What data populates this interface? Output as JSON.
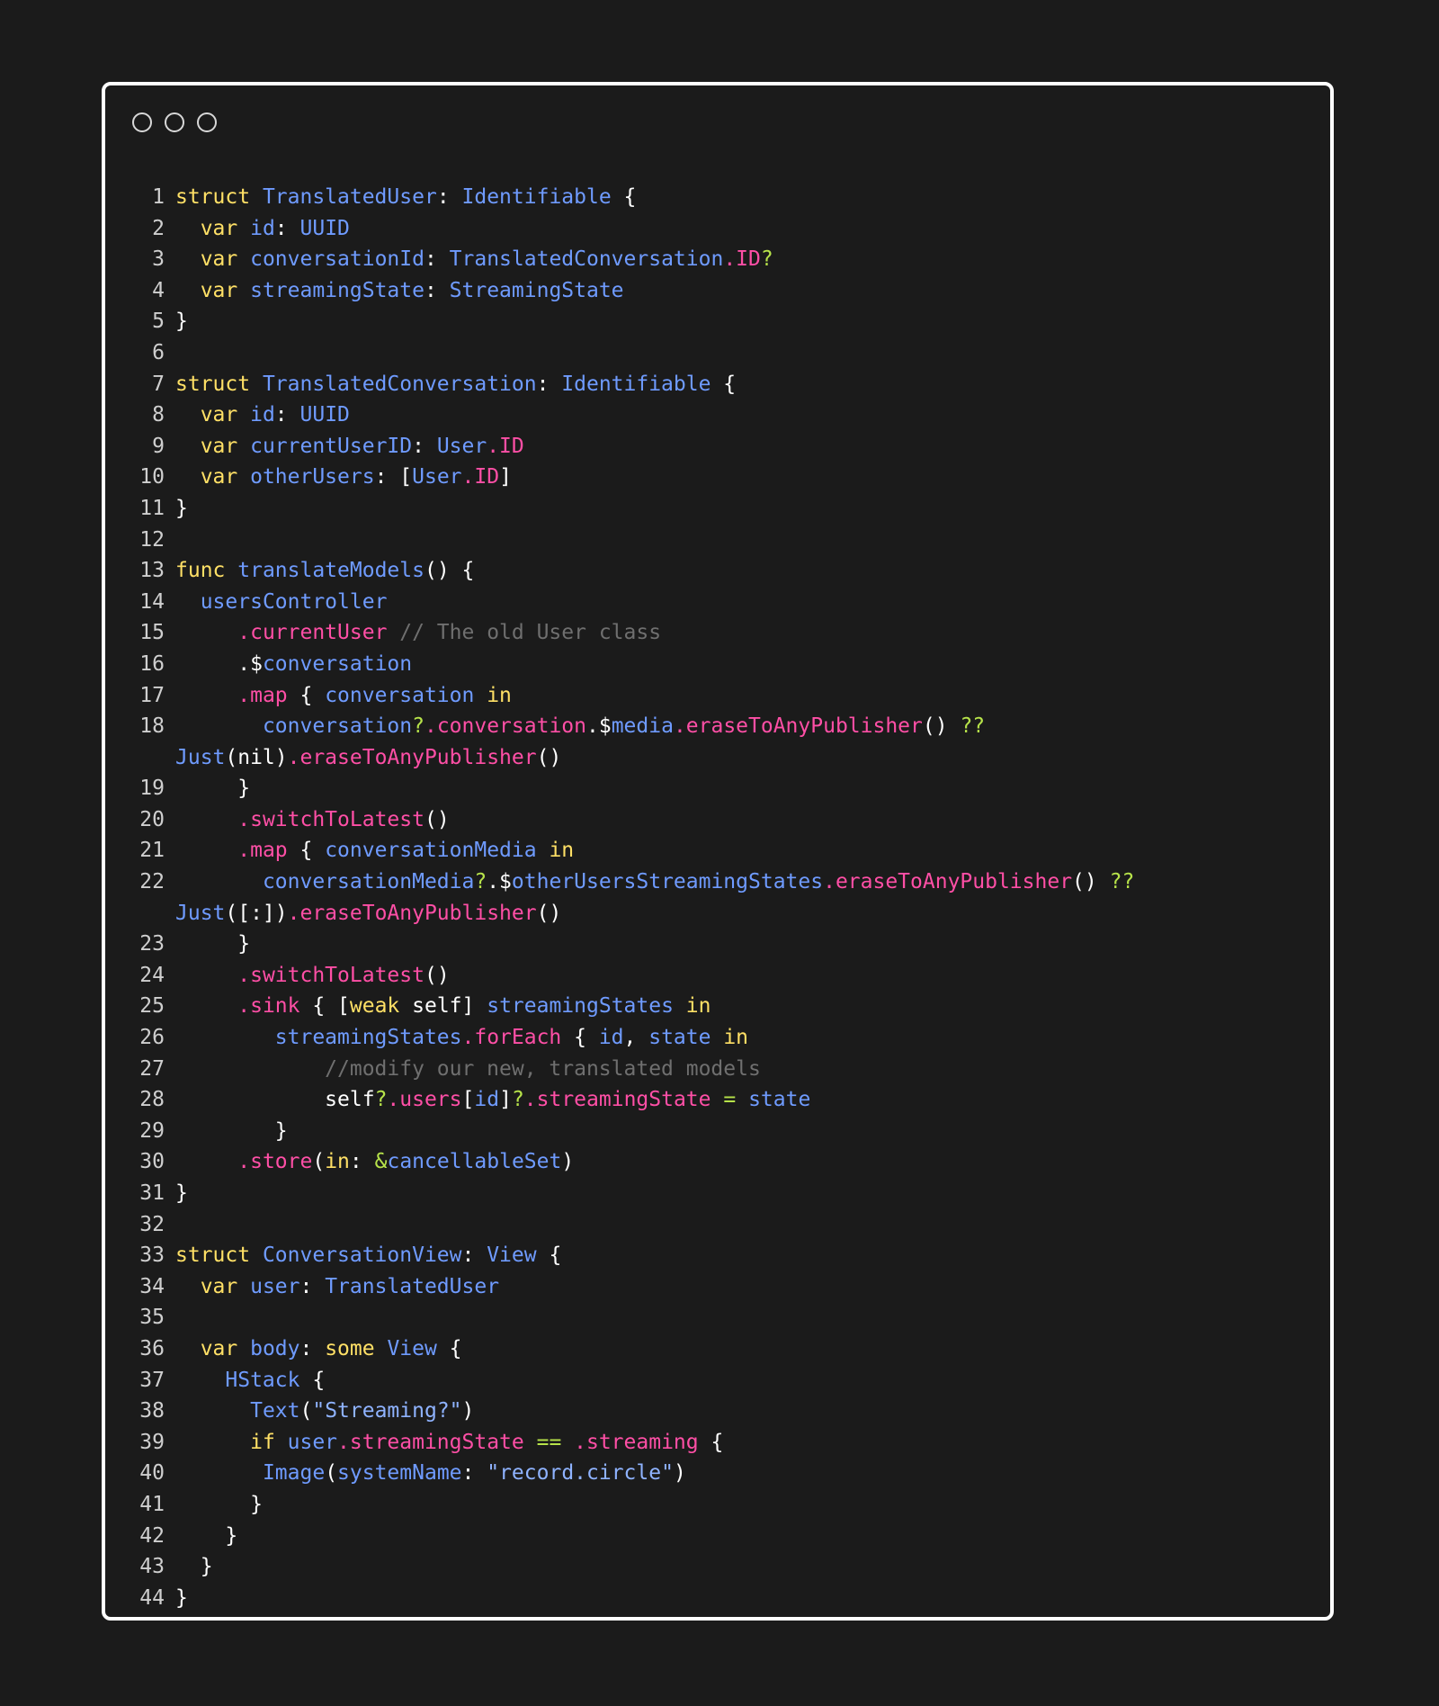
{
  "window": {
    "controls": [
      "circle-button",
      "circle-button",
      "circle-button"
    ]
  },
  "code": {
    "lines": [
      {
        "n": "1",
        "tokens": [
          [
            "k",
            "struct "
          ],
          [
            "t",
            "TranslatedUser"
          ],
          [
            "w",
            ": "
          ],
          [
            "t",
            "Identifiable"
          ],
          [
            "w",
            " {"
          ]
        ]
      },
      {
        "n": "2",
        "tokens": [
          [
            "w",
            "  "
          ],
          [
            "k",
            "var "
          ],
          [
            "t",
            "id"
          ],
          [
            "w",
            ": "
          ],
          [
            "t",
            "UUID"
          ]
        ]
      },
      {
        "n": "3",
        "tokens": [
          [
            "w",
            "  "
          ],
          [
            "k",
            "var "
          ],
          [
            "t",
            "conversationId"
          ],
          [
            "w",
            ": "
          ],
          [
            "t",
            "TranslatedConversation"
          ],
          [
            "f",
            ".ID"
          ],
          [
            "o",
            "?"
          ]
        ]
      },
      {
        "n": "4",
        "tokens": [
          [
            "w",
            "  "
          ],
          [
            "k",
            "var "
          ],
          [
            "t",
            "streamingState"
          ],
          [
            "w",
            ": "
          ],
          [
            "t",
            "StreamingState"
          ]
        ]
      },
      {
        "n": "5",
        "tokens": [
          [
            "w",
            "}"
          ]
        ]
      },
      {
        "n": "6",
        "tokens": []
      },
      {
        "n": "7",
        "tokens": [
          [
            "k",
            "struct "
          ],
          [
            "t",
            "TranslatedConversation"
          ],
          [
            "w",
            ": "
          ],
          [
            "t",
            "Identifiable"
          ],
          [
            "w",
            " {"
          ]
        ]
      },
      {
        "n": "8",
        "tokens": [
          [
            "w",
            "  "
          ],
          [
            "k",
            "var "
          ],
          [
            "t",
            "id"
          ],
          [
            "w",
            ": "
          ],
          [
            "t",
            "UUID"
          ]
        ]
      },
      {
        "n": "9",
        "tokens": [
          [
            "w",
            "  "
          ],
          [
            "k",
            "var "
          ],
          [
            "t",
            "currentUserID"
          ],
          [
            "w",
            ": "
          ],
          [
            "t",
            "User"
          ],
          [
            "f",
            ".ID"
          ]
        ]
      },
      {
        "n": "10",
        "tokens": [
          [
            "w",
            "  "
          ],
          [
            "k",
            "var "
          ],
          [
            "t",
            "otherUsers"
          ],
          [
            "w",
            ": ["
          ],
          [
            "t",
            "User"
          ],
          [
            "f",
            ".ID"
          ],
          [
            "w",
            "]"
          ]
        ]
      },
      {
        "n": "11",
        "tokens": [
          [
            "w",
            "}"
          ]
        ]
      },
      {
        "n": "12",
        "tokens": []
      },
      {
        "n": "13",
        "tokens": [
          [
            "k",
            "func "
          ],
          [
            "t",
            "translateModels"
          ],
          [
            "w",
            "() {"
          ]
        ]
      },
      {
        "n": "14",
        "tokens": [
          [
            "w",
            "  "
          ],
          [
            "t",
            "usersController"
          ]
        ]
      },
      {
        "n": "15",
        "tokens": [
          [
            "w",
            "     "
          ],
          [
            "f",
            ".currentUser "
          ],
          [
            "c",
            "// The old User class"
          ]
        ]
      },
      {
        "n": "16",
        "tokens": [
          [
            "w",
            "     .$"
          ],
          [
            "t",
            "conversation"
          ]
        ]
      },
      {
        "n": "17",
        "tokens": [
          [
            "w",
            "     "
          ],
          [
            "f",
            ".map"
          ],
          [
            "w",
            " { "
          ],
          [
            "t",
            "conversation "
          ],
          [
            "k",
            "in"
          ]
        ]
      },
      {
        "n": "18",
        "wrap": true,
        "tokens": [
          [
            "w",
            "       "
          ],
          [
            "t",
            "conversation"
          ],
          [
            "o",
            "?"
          ],
          [
            "f",
            ".conversation"
          ],
          [
            "w",
            ".$"
          ],
          [
            "t",
            "media"
          ],
          [
            "f",
            ".eraseToAnyPublisher"
          ],
          [
            "w",
            "() "
          ],
          [
            "o",
            "?? "
          ],
          [
            "t",
            "Just"
          ],
          [
            "w",
            "(nil)"
          ],
          [
            "f",
            ".eraseToAnyPublisher"
          ],
          [
            "w",
            "()"
          ]
        ]
      },
      {
        "n": "19",
        "tokens": [
          [
            "w",
            "     }"
          ]
        ]
      },
      {
        "n": "20",
        "tokens": [
          [
            "w",
            "     "
          ],
          [
            "f",
            ".switchToLatest"
          ],
          [
            "w",
            "()"
          ]
        ]
      },
      {
        "n": "21",
        "tokens": [
          [
            "w",
            "     "
          ],
          [
            "f",
            ".map"
          ],
          [
            "w",
            " { "
          ],
          [
            "t",
            "conversationMedia "
          ],
          [
            "k",
            "in"
          ]
        ]
      },
      {
        "n": "22",
        "wrap": true,
        "tokens": [
          [
            "w",
            "       "
          ],
          [
            "t",
            "conversationMedia"
          ],
          [
            "o",
            "?"
          ],
          [
            "w",
            ".$"
          ],
          [
            "t",
            "otherUsersStreamingStates"
          ],
          [
            "f",
            ".eraseToAnyPublisher"
          ],
          [
            "w",
            "() "
          ],
          [
            "o",
            "?? "
          ],
          [
            "t",
            "Just"
          ],
          [
            "w",
            "([:])"
          ],
          [
            "f",
            ".eraseToAnyPublisher"
          ],
          [
            "w",
            "()"
          ]
        ]
      },
      {
        "n": "23",
        "tokens": [
          [
            "w",
            "     }"
          ]
        ]
      },
      {
        "n": "24",
        "tokens": [
          [
            "w",
            "     "
          ],
          [
            "f",
            ".switchToLatest"
          ],
          [
            "w",
            "()"
          ]
        ]
      },
      {
        "n": "25",
        "tokens": [
          [
            "w",
            "     "
          ],
          [
            "f",
            ".sink"
          ],
          [
            "w",
            " { ["
          ],
          [
            "k",
            "weak"
          ],
          [
            "w",
            " self] "
          ],
          [
            "t",
            "streamingStates "
          ],
          [
            "k",
            "in"
          ]
        ]
      },
      {
        "n": "26",
        "tokens": [
          [
            "w",
            "        "
          ],
          [
            "t",
            "streamingStates"
          ],
          [
            "f",
            ".forEach"
          ],
          [
            "w",
            " { "
          ],
          [
            "t",
            "id"
          ],
          [
            "w",
            ", "
          ],
          [
            "t",
            "state "
          ],
          [
            "k",
            "in"
          ]
        ]
      },
      {
        "n": "27",
        "tokens": [
          [
            "w",
            "            "
          ],
          [
            "c",
            "//modify our new, translated models"
          ]
        ]
      },
      {
        "n": "28",
        "tokens": [
          [
            "w",
            "            self"
          ],
          [
            "o",
            "?"
          ],
          [
            "f",
            ".users"
          ],
          [
            "w",
            "["
          ],
          [
            "t",
            "id"
          ],
          [
            "w",
            "]"
          ],
          [
            "o",
            "?"
          ],
          [
            "f",
            ".streamingState"
          ],
          [
            "o",
            " = "
          ],
          [
            "t",
            "state"
          ]
        ]
      },
      {
        "n": "29",
        "tokens": [
          [
            "w",
            "        }"
          ]
        ]
      },
      {
        "n": "30",
        "tokens": [
          [
            "w",
            "     "
          ],
          [
            "f",
            ".store"
          ],
          [
            "w",
            "("
          ],
          [
            "k",
            "in"
          ],
          [
            "w",
            ": "
          ],
          [
            "o",
            "&"
          ],
          [
            "t",
            "cancellableSet"
          ],
          [
            "w",
            ")"
          ]
        ]
      },
      {
        "n": "31",
        "tokens": [
          [
            "w",
            "}"
          ]
        ]
      },
      {
        "n": "32",
        "tokens": []
      },
      {
        "n": "33",
        "tokens": [
          [
            "k",
            "struct "
          ],
          [
            "t",
            "ConversationView"
          ],
          [
            "w",
            ": "
          ],
          [
            "t",
            "View"
          ],
          [
            "w",
            " {"
          ]
        ]
      },
      {
        "n": "34",
        "tokens": [
          [
            "w",
            "  "
          ],
          [
            "k",
            "var "
          ],
          [
            "t",
            "user"
          ],
          [
            "w",
            ": "
          ],
          [
            "t",
            "TranslatedUser"
          ]
        ]
      },
      {
        "n": "35",
        "tokens": []
      },
      {
        "n": "36",
        "tokens": [
          [
            "w",
            "  "
          ],
          [
            "k",
            "var "
          ],
          [
            "t",
            "body"
          ],
          [
            "w",
            ": "
          ],
          [
            "k",
            "some "
          ],
          [
            "t",
            "View"
          ],
          [
            "w",
            " {"
          ]
        ]
      },
      {
        "n": "37",
        "tokens": [
          [
            "w",
            "    "
          ],
          [
            "t",
            "HStack"
          ],
          [
            "w",
            " {"
          ]
        ]
      },
      {
        "n": "38",
        "tokens": [
          [
            "w",
            "      "
          ],
          [
            "t",
            "Text"
          ],
          [
            "w",
            "("
          ],
          [
            "s",
            "\"Streaming?\""
          ],
          [
            "w",
            ")"
          ]
        ]
      },
      {
        "n": "39",
        "tokens": [
          [
            "w",
            "      "
          ],
          [
            "k",
            "if "
          ],
          [
            "t",
            "user"
          ],
          [
            "f",
            ".streamingState"
          ],
          [
            "o",
            " == "
          ],
          [
            "f",
            ".streaming"
          ],
          [
            "w",
            " {"
          ]
        ]
      },
      {
        "n": "40",
        "tokens": [
          [
            "w",
            "       "
          ],
          [
            "t",
            "Image"
          ],
          [
            "w",
            "("
          ],
          [
            "t",
            "systemName"
          ],
          [
            "w",
            ": "
          ],
          [
            "s",
            "\"record.circle\""
          ],
          [
            "w",
            ")"
          ]
        ]
      },
      {
        "n": "41",
        "tokens": [
          [
            "w",
            "      }"
          ]
        ]
      },
      {
        "n": "42",
        "tokens": [
          [
            "w",
            "    }"
          ]
        ]
      },
      {
        "n": "43",
        "tokens": [
          [
            "w",
            "  }"
          ]
        ]
      },
      {
        "n": "44",
        "tokens": [
          [
            "w",
            "}"
          ]
        ]
      }
    ]
  }
}
